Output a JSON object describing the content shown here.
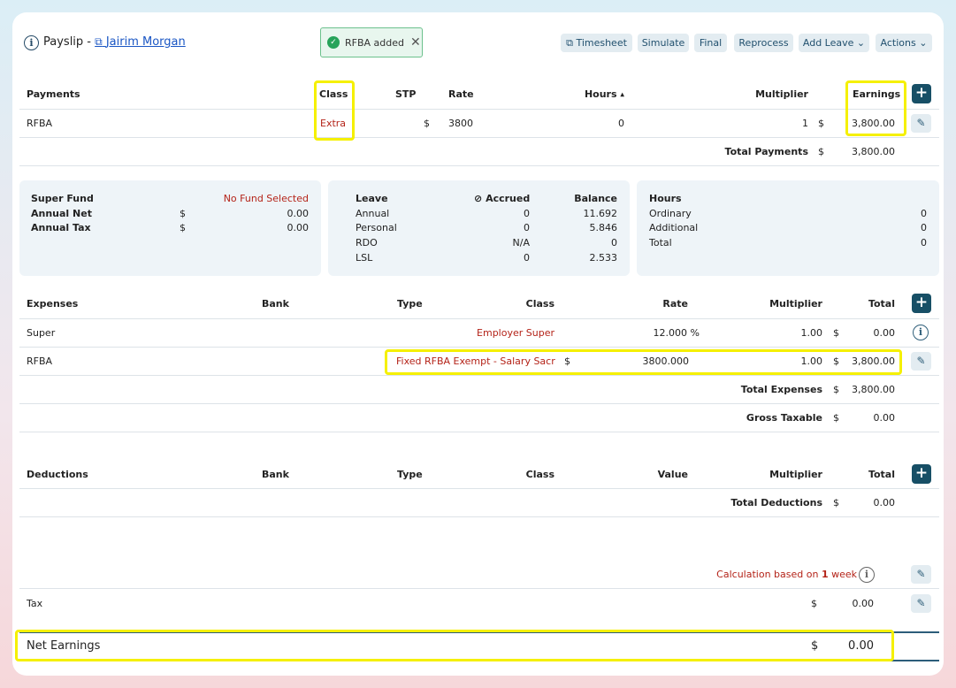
{
  "header": {
    "title_prefix": "Payslip - ",
    "employee_name": "Jairim Morgan",
    "toast": "RFBA added",
    "buttons": {
      "timesheet": "Timesheet",
      "simulate": "Simulate",
      "final": "Final",
      "reprocess": "Reprocess",
      "add_leave": "Add Leave",
      "actions": "Actions"
    }
  },
  "payments": {
    "headers": {
      "payments": "Payments",
      "class": "Class",
      "stp": "STP",
      "rate": "Rate",
      "hours": "Hours",
      "sort_indicator": "▲",
      "multiplier": "Multiplier",
      "earnings": "Earnings"
    },
    "row": {
      "name": "RFBA",
      "class": "Extra",
      "currency": "$",
      "rate": "3800",
      "hours": "0",
      "multiplier": "1",
      "earnings_currency": "$",
      "earnings": "3,800.00"
    },
    "total_label": "Total Payments",
    "total_currency": "$",
    "total": "3,800.00"
  },
  "summary": {
    "super_fund_label": "Super Fund",
    "super_fund_value": "No Fund Selected",
    "annual_net_label": "Annual Net",
    "annual_net_currency": "$",
    "annual_net": "0.00",
    "annual_tax_label": "Annual Tax",
    "annual_tax_currency": "$",
    "annual_tax": "0.00"
  },
  "leave": {
    "headers": {
      "leave": "Leave",
      "accrued": "Accrued",
      "balance": "Balance"
    },
    "rows": [
      {
        "name": "Annual",
        "accrued": "0",
        "balance": "11.692"
      },
      {
        "name": "Personal",
        "accrued": "0",
        "balance": "5.846"
      },
      {
        "name": "RDO",
        "accrued": "N/A",
        "balance": "0"
      },
      {
        "name": "LSL",
        "accrued": "0",
        "balance": "2.533"
      }
    ]
  },
  "hours": {
    "header": "Hours",
    "rows": [
      {
        "name": "Ordinary",
        "value": "0"
      },
      {
        "name": "Additional",
        "value": "0"
      },
      {
        "name": "Total",
        "value": "0"
      }
    ]
  },
  "expenses": {
    "headers": {
      "expenses": "Expenses",
      "bank": "Bank",
      "type": "Type",
      "class": "Class",
      "rate": "Rate",
      "multiplier": "Multiplier",
      "total": "Total"
    },
    "rows": [
      {
        "name": "Super",
        "class": "Employer Super",
        "rate_currency": "",
        "rate": "12.000 %",
        "multiplier": "1.00",
        "currency": "$",
        "total": "0.00"
      },
      {
        "name": "RFBA",
        "class": "Fixed RFBA Exempt - Salary Sacri...",
        "rate_currency": "$",
        "rate": "3800.000",
        "multiplier": "1.00",
        "currency": "$",
        "total": "3,800.00"
      }
    ],
    "total_label": "Total Expenses",
    "total_currency": "$",
    "total": "3,800.00",
    "gross_label": "Gross Taxable",
    "gross_currency": "$",
    "gross": "0.00"
  },
  "deductions": {
    "headers": {
      "deductions": "Deductions",
      "bank": "Bank",
      "type": "Type",
      "class": "Class",
      "value": "Value",
      "multiplier": "Multiplier",
      "total": "Total"
    },
    "total_label": "Total Deductions",
    "total_currency": "$",
    "total": "0.00"
  },
  "calculation": {
    "prefix": "Calculation based on ",
    "count": "1",
    "unit": " week"
  },
  "tax": {
    "label": "Tax",
    "currency": "$",
    "value": "0.00"
  },
  "net": {
    "label": "Net Earnings",
    "currency": "$",
    "value": "0.00"
  },
  "colors": {
    "accent": "#174f66",
    "highlight": "#f5f000",
    "class_text": "#b42318",
    "toast_green": "#27a35a"
  }
}
